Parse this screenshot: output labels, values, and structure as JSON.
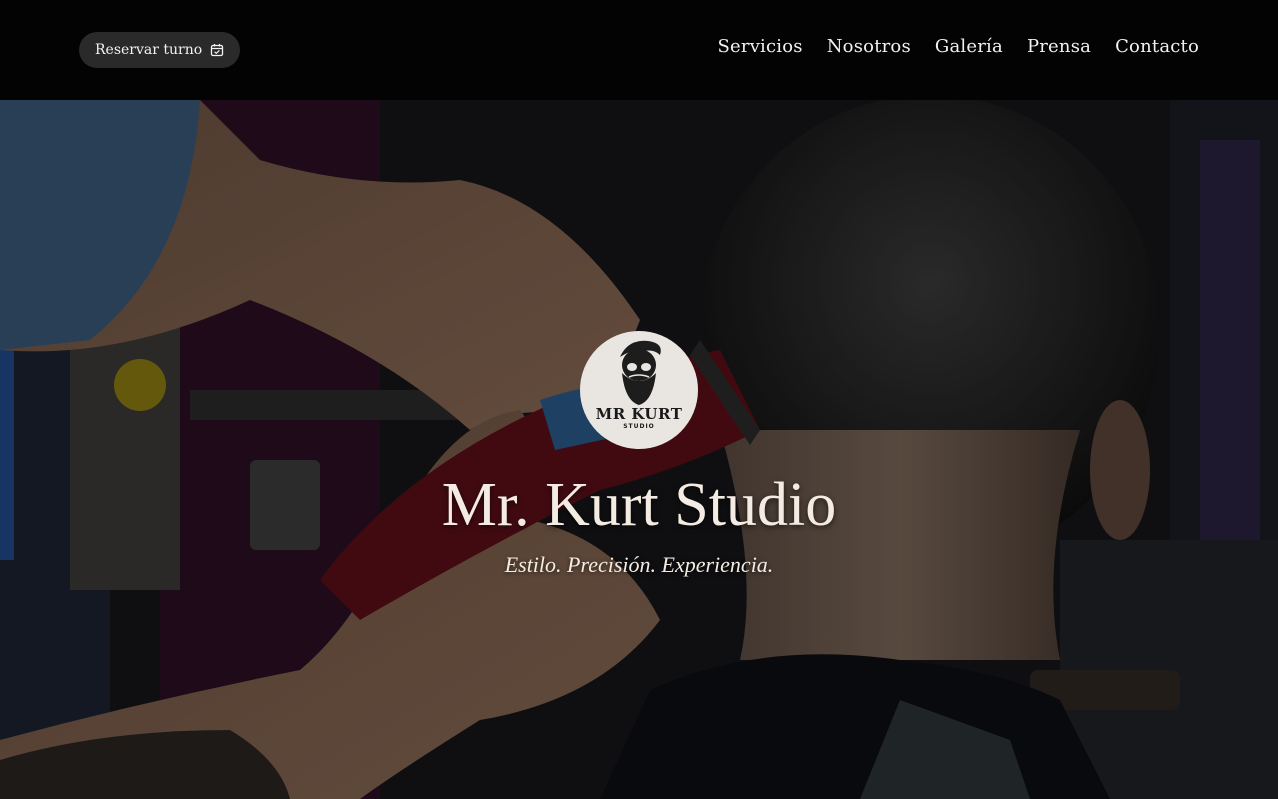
{
  "header": {
    "reserve_label": "Reservar turno",
    "reserve_icon": "calendar-check-icon",
    "nav": [
      {
        "label": "Servicios"
      },
      {
        "label": "Nosotros"
      },
      {
        "label": "Galería"
      },
      {
        "label": "Prensa"
      },
      {
        "label": "Contacto"
      }
    ]
  },
  "hero": {
    "logo": {
      "name": "MR KURT",
      "sub": "STUDIO"
    },
    "title": "Mr. Kurt Studio",
    "tagline": "Estilo. Precisión. Experiencia."
  },
  "colors": {
    "header_bg": "#030303",
    "button_bg": "#2a2a2a",
    "text": "#f2f2f2",
    "hero_text": "#f4ece2"
  }
}
